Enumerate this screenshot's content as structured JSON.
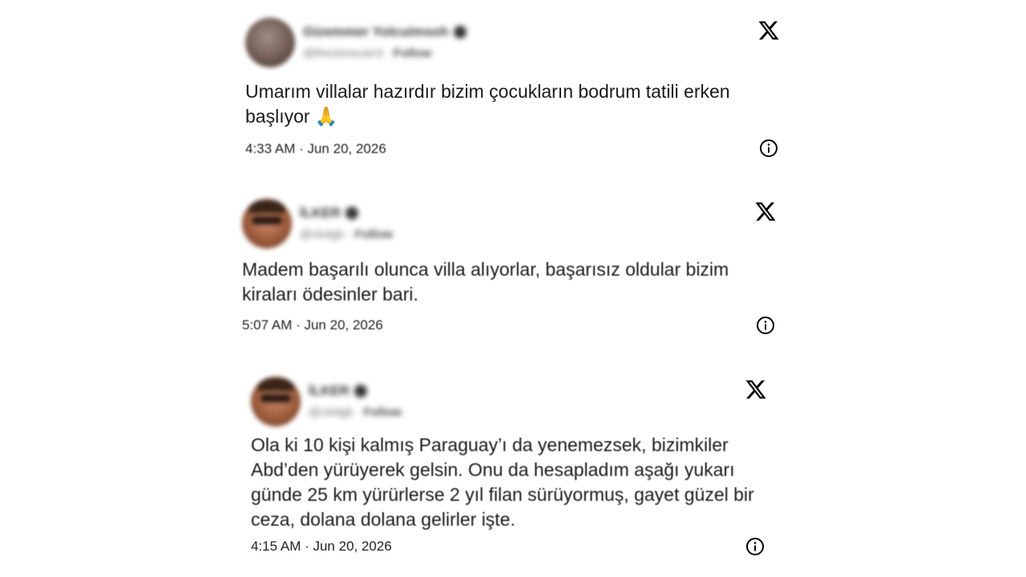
{
  "tweets": [
    {
      "user_name": "Gizemmer Yolcuimsoh",
      "user_handle": "@thesimscan3",
      "user_action": "Follow",
      "text": "Umarım villalar hazırdır bizim çocukların bodrum tatili erken başlıyor 🙏",
      "timestamp": "4:33 AM · Jun 20, 2026",
      "logo_icon": "x-logo-icon",
      "info_icon": "info-icon"
    },
    {
      "user_name": "İLKER",
      "user_handle": "@ckdgb",
      "user_action": "Follow",
      "text": "Madem başarılı olunca villa alıyorlar, başarısız oldular bizim kiraları ödesinler bari.",
      "timestamp": "5:07 AM · Jun 20, 2026",
      "logo_icon": "x-logo-icon",
      "info_icon": "info-icon"
    },
    {
      "user_name": "İLKER",
      "user_handle": "@ckdgb",
      "user_action": "Follow",
      "text": "Ola ki 10 kişi kalmış Paraguay’ı da yenemezsek, bizimkiler Abd’den yürüyerek gelsin. Onu da hesapladım aşağı yukarı günde 25 km yürürlerse 2 yıl filan sürüyormuş, gayet güzel bir ceza, dolana dolana gelirler işte.",
      "timestamp": "4:15 AM · Jun 20, 2026",
      "logo_icon": "x-logo-icon",
      "info_icon": "info-icon"
    }
  ]
}
